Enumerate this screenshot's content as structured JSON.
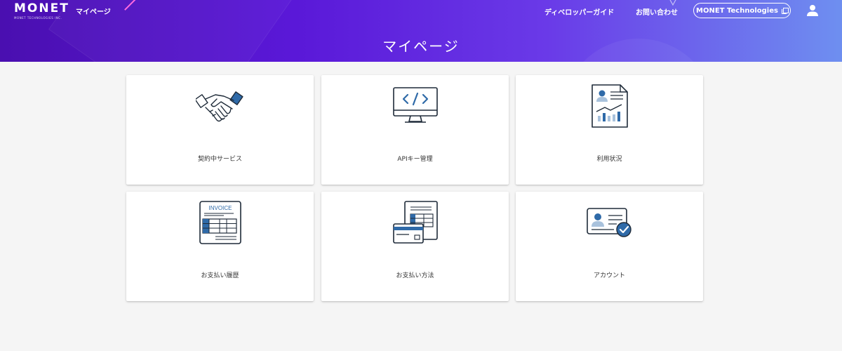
{
  "header": {
    "logo_text": "MONET",
    "logo_sub": "MONET TECHNOLOGIES INC.",
    "nav_mypage": "マイページ",
    "nav_guide": "ディベロッパーガイド",
    "nav_contact": "お問い合わせ",
    "nav_company": "MONET Technologies",
    "page_title": "マイページ"
  },
  "cards": [
    {
      "label": "契約中サービス",
      "icon": "handshake-icon"
    },
    {
      "label": "APIキー管理",
      "icon": "code-monitor-icon"
    },
    {
      "label": "利用状況",
      "icon": "usage-report-icon"
    },
    {
      "label": "お支払い履歴",
      "icon": "invoice-icon"
    },
    {
      "label": "お支払い方法",
      "icon": "credit-card-icon"
    },
    {
      "label": "アカウント",
      "icon": "account-card-icon"
    }
  ],
  "colors": {
    "header_start": "#4a0fb0",
    "header_end": "#6e8ff0",
    "icon_blue": "#2f6aa8",
    "icon_dark": "#1e2a38"
  },
  "invoice_word": "INVOICE"
}
